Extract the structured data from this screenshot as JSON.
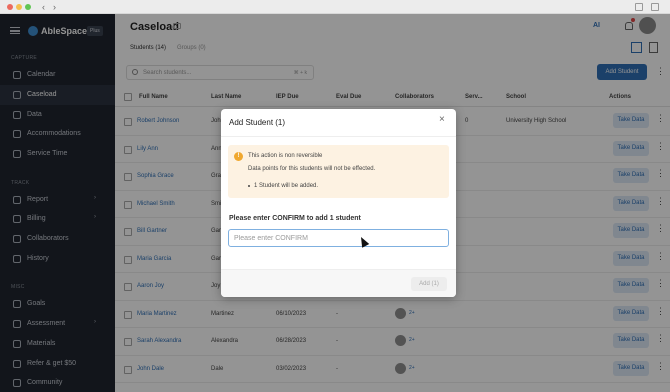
{
  "app": {
    "brand": "AbleSpace",
    "plan": "Plus"
  },
  "sidebar": {
    "sections": {
      "capture": "CAPTURE",
      "track": "TRACK",
      "misc": "MISC"
    },
    "items": [
      {
        "label": "Calendar",
        "icon": "calendar-icon"
      },
      {
        "label": "Caseload",
        "icon": "users-icon",
        "active": true
      },
      {
        "label": "Data",
        "icon": "person-icon"
      },
      {
        "label": "Accommodations",
        "icon": "accommodations-icon"
      },
      {
        "label": "Service Time",
        "icon": "clock-icon"
      },
      {
        "label": "Report",
        "icon": "chart-icon",
        "arrow": "›"
      },
      {
        "label": "Billing",
        "icon": "billing-icon",
        "arrow": "›"
      },
      {
        "label": "Collaborators",
        "icon": "collaborators-icon"
      },
      {
        "label": "History",
        "icon": "history-icon"
      },
      {
        "label": "Goals",
        "icon": "goals-icon"
      },
      {
        "label": "Assessment",
        "icon": "assessment-icon",
        "arrow": "›"
      },
      {
        "label": "Materials",
        "icon": "materials-icon"
      },
      {
        "label": "Refer & get $50",
        "icon": "dollar-icon"
      },
      {
        "label": "Community",
        "icon": "community-icon"
      }
    ]
  },
  "header": {
    "title": "Caseload",
    "ai_label": "AI"
  },
  "tabs": [
    {
      "label": "Students (14)",
      "active": true
    },
    {
      "label": "Groups (0)",
      "active": false
    }
  ],
  "search": {
    "placeholder": "Search students...",
    "shortcut": "⌘ + k"
  },
  "toolbar": {
    "add_student": "Add Student"
  },
  "table": {
    "columns": [
      "Full Name",
      "Last Name",
      "IEP Due",
      "Eval Due",
      "Collaborators",
      "Serv...",
      "School",
      "Actions"
    ],
    "take_data_label": "Take Data",
    "rows": [
      {
        "full_name": "Robert Johnson",
        "last_name": "Joh",
        "iep_due": "",
        "eval_due": "",
        "serv": "0",
        "school": "University High School",
        "collab": false
      },
      {
        "full_name": "Lily Ann",
        "last_name": "Ann",
        "iep_due": "",
        "eval_due": "",
        "serv": "",
        "school": "",
        "collab": false
      },
      {
        "full_name": "Sophia Grace",
        "last_name": "Gra",
        "iep_due": "",
        "eval_due": "",
        "serv": "",
        "school": "",
        "collab": false
      },
      {
        "full_name": "Michael Smith",
        "last_name": "Smi",
        "iep_due": "",
        "eval_due": "",
        "serv": "",
        "school": "",
        "collab": false
      },
      {
        "full_name": "Bill Gartner",
        "last_name": "Gar",
        "iep_due": "",
        "eval_due": "",
        "serv": "",
        "school": "",
        "collab": false
      },
      {
        "full_name": "Maria Garcia",
        "last_name": "Gar",
        "iep_due": "",
        "eval_due": "",
        "serv": "",
        "school": "",
        "collab": false
      },
      {
        "full_name": "Aaron Joy",
        "last_name": "Joy",
        "iep_due": "",
        "eval_due": "",
        "serv": "",
        "school": "",
        "collab": false
      },
      {
        "full_name": "Maria Martinez",
        "last_name": "Martinez",
        "iep_due": "06/10/2023",
        "eval_due": "-",
        "serv": "",
        "school": "",
        "collab": true
      },
      {
        "full_name": "Sarah Alexandra",
        "last_name": "Alexandra",
        "iep_due": "06/28/2023",
        "eval_due": "-",
        "serv": "",
        "school": "",
        "collab": true
      },
      {
        "full_name": "John Dale",
        "last_name": "Dale",
        "iep_due": "03/02/2023",
        "eval_due": "-",
        "serv": "",
        "school": "",
        "collab": true
      }
    ]
  },
  "modal": {
    "title": "Add Student (1)",
    "close_icon": "close-icon",
    "warning_title": "This action is non reversible",
    "warning_body": "Data points for this students will not be effected.",
    "warning_item": "1 Student will be added.",
    "confirm_label": "Please enter CONFIRM to add 1 student",
    "confirm_placeholder": "Please enter CONFIRM",
    "confirm_value": "",
    "add_button": "Add (1)"
  },
  "colors": {
    "accent": "#2f6fb5",
    "sidebar": "#1f2530",
    "warning_bg": "#fdf2e2",
    "warning_icon": "#f0a830"
  }
}
